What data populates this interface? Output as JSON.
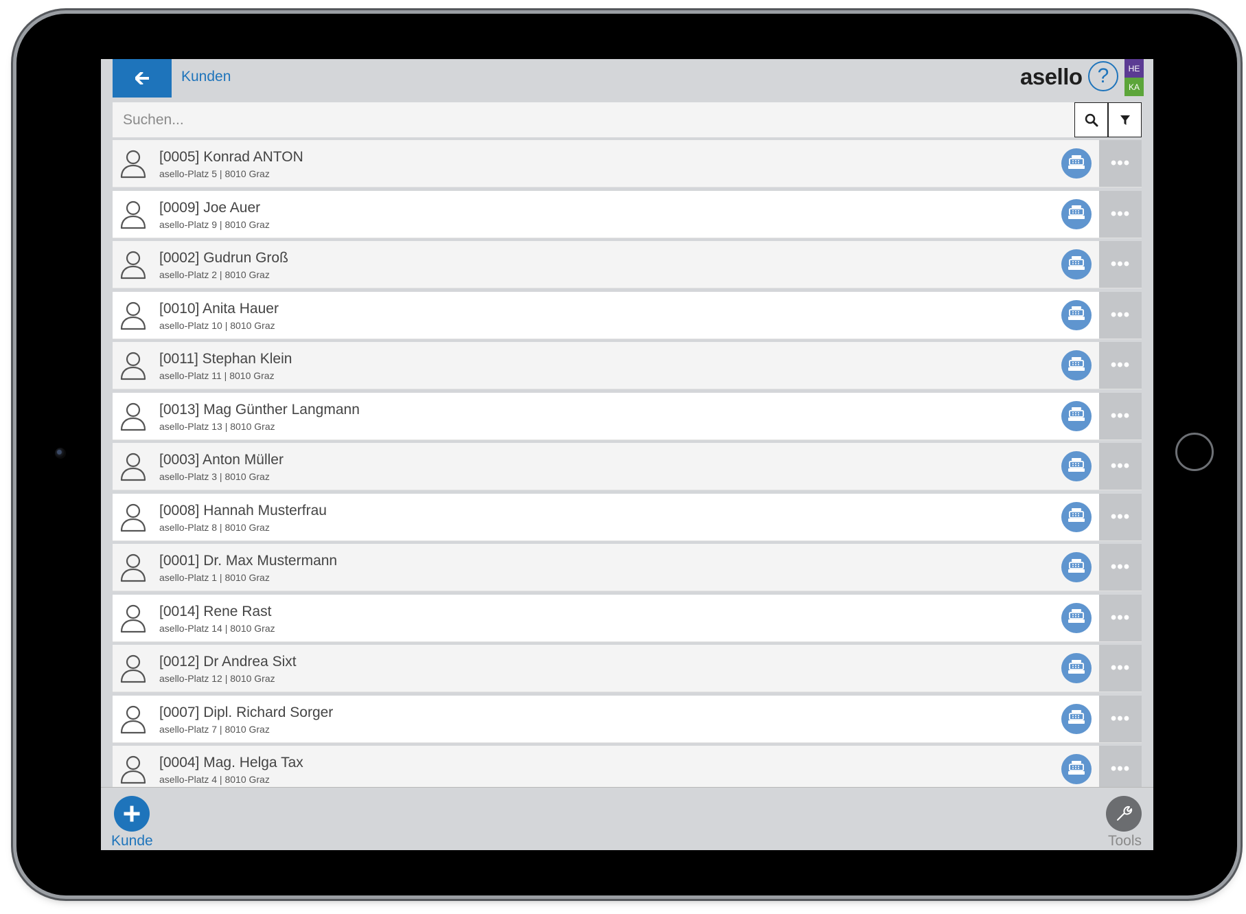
{
  "header": {
    "back_icon": "arrow-left-icon",
    "title": "Kunden",
    "logo": "asello",
    "help_icon": "question-circle-icon",
    "badges": [
      "HE",
      "KA"
    ]
  },
  "search": {
    "placeholder": "Suchen...",
    "value": "",
    "search_icon": "search-icon",
    "filter_icon": "filter-icon"
  },
  "customers": [
    {
      "name": "[0005] Konrad ANTON",
      "address": "asello-Platz 5 | 8010 Graz"
    },
    {
      "name": "[0009] Joe Auer",
      "address": "asello-Platz 9 | 8010 Graz"
    },
    {
      "name": "[0002] Gudrun Groß",
      "address": "asello-Platz 2 | 8010 Graz"
    },
    {
      "name": "[0010] Anita Hauer",
      "address": "asello-Platz 10 | 8010 Graz"
    },
    {
      "name": "[0011] Stephan Klein",
      "address": "asello-Platz 11 | 8010 Graz"
    },
    {
      "name": "[0013] Mag Günther Langmann",
      "address": "asello-Platz 13 | 8010 Graz"
    },
    {
      "name": "[0003] Anton Müller",
      "address": "asello-Platz 3 | 8010 Graz"
    },
    {
      "name": "[0008] Hannah Musterfrau",
      "address": "asello-Platz 8 | 8010 Graz"
    },
    {
      "name": "[0001] Dr. Max Mustermann",
      "address": "asello-Platz 1 | 8010 Graz"
    },
    {
      "name": "[0014] Rene Rast",
      "address": "asello-Platz 14 | 8010 Graz"
    },
    {
      "name": "[0012] Dr Andrea Sixt",
      "address": "asello-Platz 12 | 8010 Graz"
    },
    {
      "name": "[0007] Dipl. Richard Sorger",
      "address": "asello-Platz 7 | 8010 Graz"
    },
    {
      "name": "[0004] Mag. Helga Tax",
      "address": "asello-Platz 4 | 8010 Graz"
    }
  ],
  "row_icons": {
    "avatar": "user-icon",
    "register": "cash-register-icon",
    "more": "more-dots-icon"
  },
  "footer": {
    "add_label": "Kunde",
    "add_icon": "plus-icon",
    "tools_label": "Tools",
    "tools_icon": "wrench-icon"
  },
  "colors": {
    "accent": "#1e74bb",
    "register_button": "#5f95cf",
    "more_button": "#c4c6c9",
    "badge_he": "#5b3b93",
    "badge_ka": "#5ca53a"
  }
}
